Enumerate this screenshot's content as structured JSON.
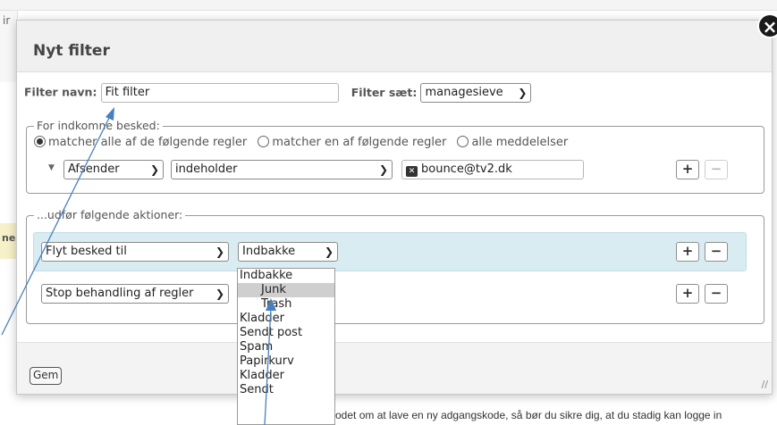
{
  "background": {
    "left_top_text": "ir",
    "left_mid_text": "ne",
    "bottom_text": "odet om at lave en ny adgangskode, så bør du sikre dig, at du stadig kan logge in"
  },
  "dialog": {
    "title": "Nyt filter",
    "close_icon": "close-icon",
    "name_label": "Filter navn:",
    "name_value": "Fit filter",
    "set_label": "Filter sæt:",
    "set_value": "managesieve",
    "incoming": {
      "legend": "For indkomne besked:",
      "options": [
        "matcher alle af de følgende regler",
        "matcher en af følgende regler",
        "alle meddelelser"
      ],
      "selected_index": 0,
      "rule": {
        "header": "Afsender",
        "operator": "indeholder",
        "value": "bounce@tv2.dk",
        "value_icon": "delete-icon"
      },
      "add_label": "+",
      "remove_label": "−"
    },
    "actions": {
      "legend": "...udfør følgende aktioner:",
      "rows": [
        {
          "action": "Flyt besked til",
          "target": "Indbakke",
          "add_label": "+",
          "remove_label": "−"
        },
        {
          "action": "Stop behandling af regler",
          "add_label": "+",
          "remove_label": "−"
        }
      ]
    },
    "dropdown_options": [
      "Indbakke",
      "Junk",
      "Trash",
      "Kladder",
      "Sendt post",
      "Spam",
      "Papirkurv",
      "Kladder",
      "Sendt"
    ],
    "dropdown_highlight_index": 1,
    "save_label": "Gem"
  },
  "colors": {
    "action_row_bg": "#d8ecf2",
    "arrow": "#4a7fbf",
    "header_bg": "#f0f0f0"
  }
}
